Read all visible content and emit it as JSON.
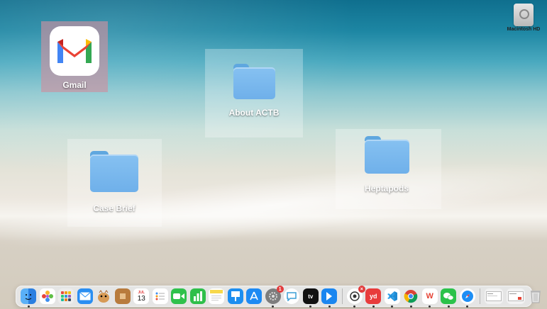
{
  "desktop": {
    "icons": {
      "gmail": {
        "label": "Gmail"
      },
      "about_actb": {
        "label": "About ACTB"
      },
      "case_brief": {
        "label": "Case Brief"
      },
      "heptapods": {
        "label": "Heptapods"
      },
      "macintosh_hd": {
        "label": "Macintosh HD"
      }
    }
  },
  "dock": {
    "calendar": {
      "month": "JUL",
      "day": "13"
    },
    "system_settings": {
      "badge": "1"
    },
    "apple_tv": {
      "label": "tv"
    },
    "youdao": {
      "label": "yd"
    },
    "wps": {
      "label": "W"
    },
    "items": [
      {
        "name": "finder",
        "icon": "finder-icon",
        "color": "#2b8ef0",
        "running": true
      },
      {
        "name": "photos",
        "icon": "photos-icon",
        "color": "#f4a623",
        "running": false
      },
      {
        "name": "launchpad",
        "icon": "launchpad-icon",
        "color": "#e6e6e6",
        "running": false
      },
      {
        "name": "mail",
        "icon": "mail-icon",
        "color": "#2a8ef2",
        "running": false
      },
      {
        "name": "dragon-app",
        "icon": "dragon-icon",
        "color": "#d79a55",
        "running": false
      },
      {
        "name": "notebook",
        "icon": "notebook-icon",
        "color": "#b87b3d",
        "running": false
      },
      {
        "name": "calendar",
        "icon": "calendar-icon",
        "color": "#ffffff",
        "running": false
      },
      {
        "name": "reminders",
        "icon": "reminders-icon",
        "color": "#ffffff",
        "running": false
      },
      {
        "name": "facetime",
        "icon": "facetime-icon",
        "color": "#2fc14c",
        "running": false
      },
      {
        "name": "numbers",
        "icon": "numbers-icon",
        "color": "#2fbf4a",
        "running": false
      },
      {
        "name": "notes",
        "icon": "notes-icon",
        "color": "#f7d84a",
        "running": false
      },
      {
        "name": "keynote",
        "icon": "keynote-icon",
        "color": "#1c8ef0",
        "running": false
      },
      {
        "name": "app-store",
        "icon": "app-store-icon",
        "color": "#1d8af3",
        "running": false
      },
      {
        "name": "system-settings",
        "icon": "gear-icon",
        "color": "#7d7d7d",
        "running": true
      },
      {
        "name": "quick-ai",
        "icon": "chat-bubble-icon",
        "color": "#ffffff",
        "running": false
      },
      {
        "name": "apple-tv",
        "icon": "apple-tv-icon",
        "color": "#111111",
        "running": true
      },
      {
        "name": "prompt",
        "icon": "arrow-icon",
        "color": "#1a86f0",
        "running": true
      },
      {
        "name": "screen-capture",
        "icon": "capture-icon",
        "color": "#ffffff",
        "running": true
      },
      {
        "name": "youdao-dict",
        "icon": "youdao-icon",
        "color": "#e83c3c",
        "running": true
      },
      {
        "name": "vscode",
        "icon": "vscode-icon",
        "color": "#1f8ad2",
        "running": true
      },
      {
        "name": "chrome",
        "icon": "chrome-icon",
        "color": "#ffffff",
        "running": true
      },
      {
        "name": "wps",
        "icon": "wps-icon",
        "color": "#e54335",
        "running": true
      },
      {
        "name": "wechat",
        "icon": "wechat-icon",
        "color": "#2bc24a",
        "running": true
      },
      {
        "name": "safari",
        "icon": "safari-icon",
        "color": "#1d8ef5",
        "running": true
      },
      {
        "name": "finder-window-1",
        "icon": "window-thumb-icon",
        "color": "#f2f2f2",
        "running": false
      },
      {
        "name": "finder-window-2",
        "icon": "window-thumb-icon",
        "color": "#f2f2f2",
        "running": false
      },
      {
        "name": "trash",
        "icon": "trash-icon",
        "color": "#d9d9d9",
        "running": false
      }
    ]
  }
}
